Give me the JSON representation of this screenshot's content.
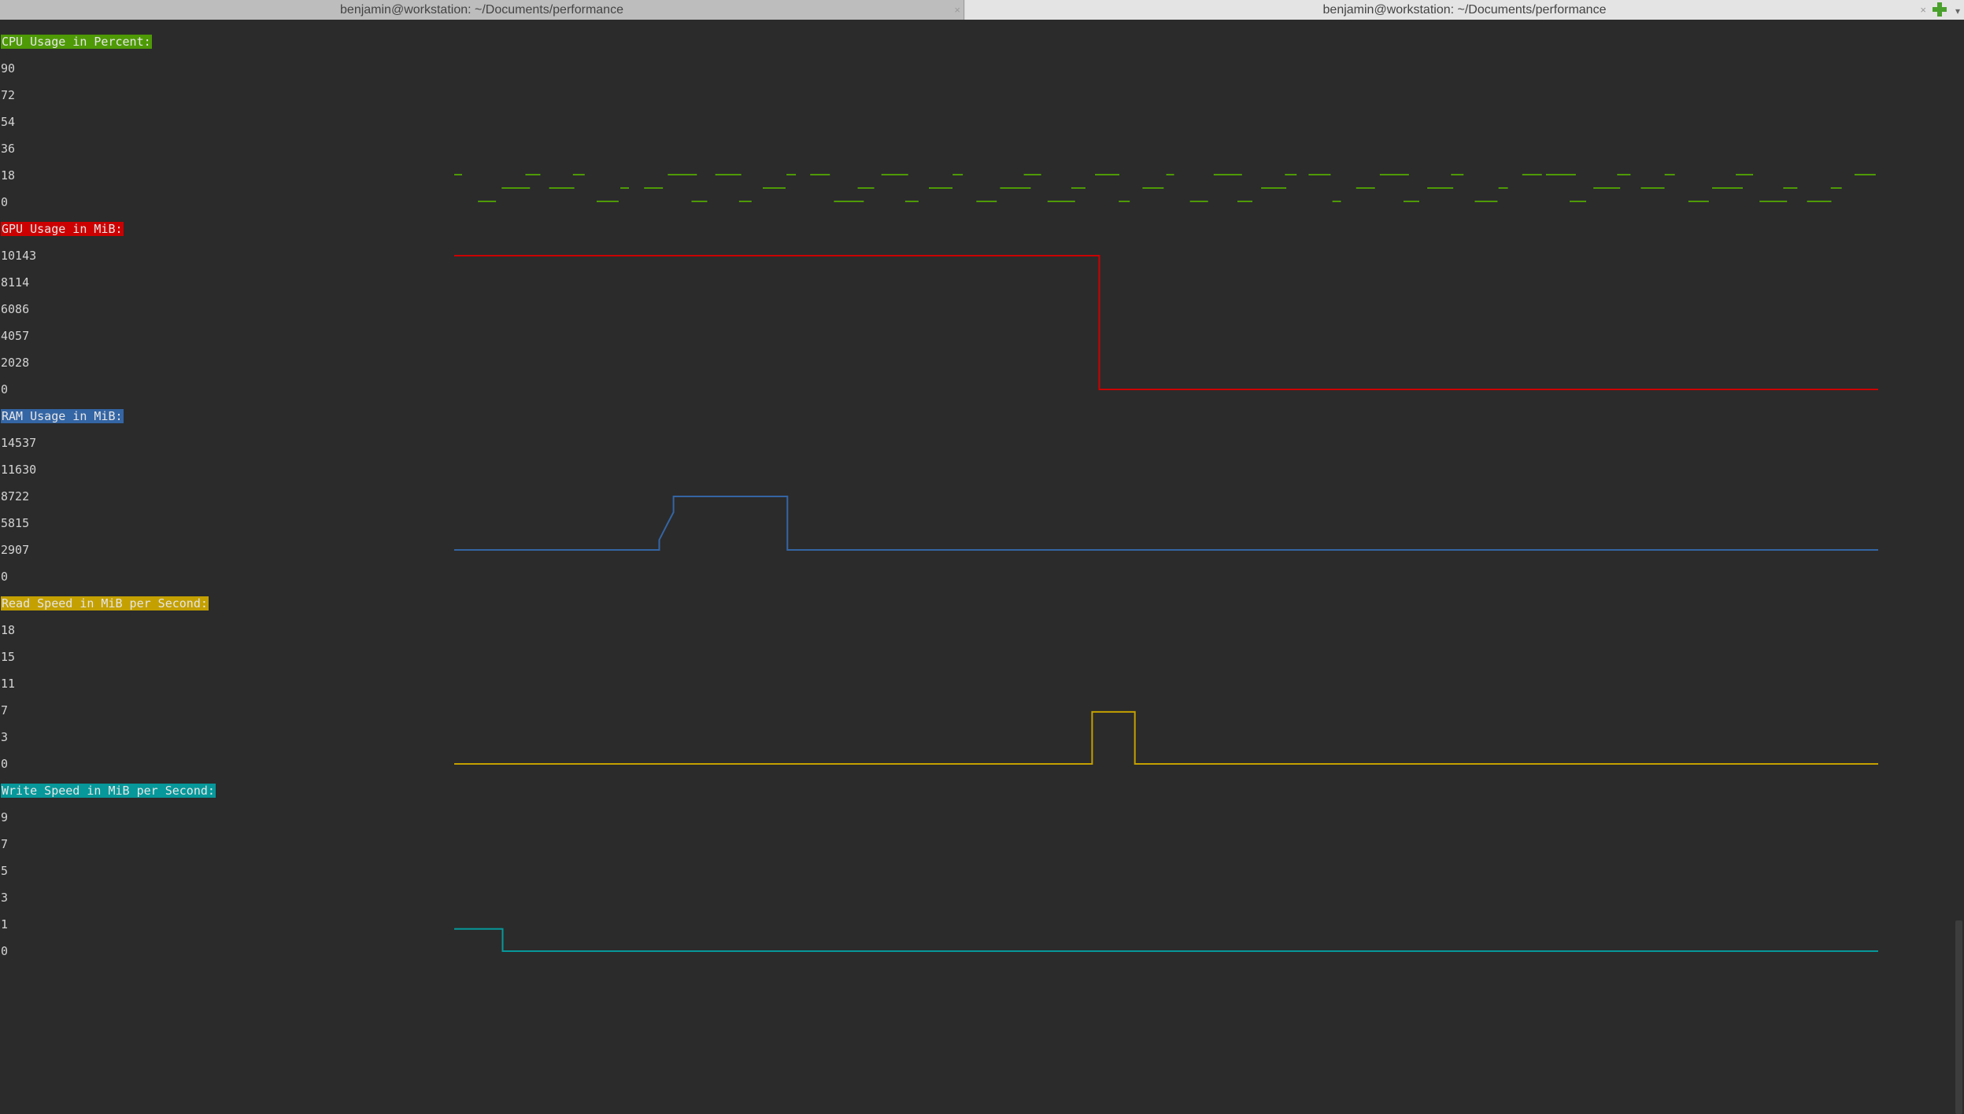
{
  "tabs": [
    {
      "title": "benjamin@workstation: ~/Documents/performance",
      "active": false
    },
    {
      "title": "benjamin@workstation: ~/Documents/performance",
      "active": true
    }
  ],
  "icons": {
    "close": "close-icon",
    "add_tab": "plus-icon",
    "menu": "chevron-down-icon"
  },
  "sections": [
    {
      "title": "CPU Usage in Percent:",
      "color": "#4e9a06",
      "ticks": [
        "90",
        "72",
        "54",
        "36",
        "18",
        "0"
      ]
    },
    {
      "title": "GPU Usage in MiB:",
      "color": "#cc0000",
      "ticks": [
        "10143",
        "8114",
        "6086",
        "4057",
        "2028",
        "0"
      ]
    },
    {
      "title": "RAM Usage in MiB:",
      "color": "#3465a4",
      "ticks": [
        "14537",
        "11630",
        "8722",
        "5815",
        "2907",
        "0"
      ]
    },
    {
      "title": "Read Speed in MiB per Second:",
      "color": "#c4a000",
      "ticks": [
        "18",
        "15",
        "11",
        "7",
        "3",
        "0"
      ]
    },
    {
      "title": "Write Speed in MiB per Second:",
      "color": "#06989a",
      "ticks": [
        "9",
        "7",
        "5",
        "3",
        "1",
        "0"
      ]
    }
  ],
  "chart_data": [
    {
      "type": "line",
      "title": "CPU Usage in Percent:",
      "ylim": [
        0,
        90
      ],
      "x_range": [
        0,
        100
      ],
      "series": [
        {
          "values": [
            [
              0,
              5
            ],
            [
              0,
              9
            ],
            [
              8,
              11
            ],
            [
              8,
              15
            ],
            [
              8,
              20
            ],
            [
              15,
              20
            ],
            [
              20,
              2
            ],
            [
              30,
              20
            ],
            [
              31,
              14
            ],
            [
              40,
              21
            ],
            [
              45,
              14
            ],
            [
              50,
              20
            ],
            [
              60,
              26
            ],
            [
              70,
              28
            ],
            [
              75,
              17
            ],
            [
              80,
              20
            ],
            [
              95,
              18
            ],
            [
              100,
              12
            ]
          ]
        }
      ]
    },
    {
      "type": "line",
      "title": "GPU Usage in MiB:",
      "ylim": [
        0,
        10143
      ],
      "x_range": [
        0,
        100
      ],
      "series": [
        {
          "values": [
            [
              0,
              10143
            ],
            [
              45.3,
              10143
            ],
            [
              45.3,
              0
            ],
            [
              100,
              0
            ]
          ]
        }
      ]
    },
    {
      "type": "line",
      "title": "RAM Usage in MiB:",
      "ylim": [
        0,
        14537
      ],
      "x_range": [
        0,
        100
      ],
      "series": [
        {
          "values": [
            [
              0,
              2907
            ],
            [
              14.4,
              2907
            ],
            [
              14.4,
              4000
            ],
            [
              15.0,
              5815
            ],
            [
              15.4,
              7000
            ],
            [
              15.4,
              8722
            ],
            [
              23.4,
              8722
            ],
            [
              23.4,
              2907
            ],
            [
              100,
              2907
            ]
          ]
        }
      ]
    },
    {
      "type": "line",
      "title": "Read Speed in MiB per Second:",
      "ylim": [
        0,
        18
      ],
      "x_range": [
        0,
        100
      ],
      "series": [
        {
          "values": [
            [
              0,
              0
            ],
            [
              44.8,
              0
            ],
            [
              44.8,
              7
            ],
            [
              47.8,
              7
            ],
            [
              47.8,
              0
            ],
            [
              100,
              0
            ]
          ]
        }
      ]
    },
    {
      "type": "line",
      "title": "Write Speed in MiB per Second:",
      "ylim": [
        0,
        9
      ],
      "x_range": [
        0,
        100
      ],
      "series": [
        {
          "values": [
            [
              0,
              1.5
            ],
            [
              3.4,
              1.5
            ],
            [
              3.4,
              0
            ],
            [
              100,
              0
            ]
          ]
        }
      ]
    }
  ]
}
